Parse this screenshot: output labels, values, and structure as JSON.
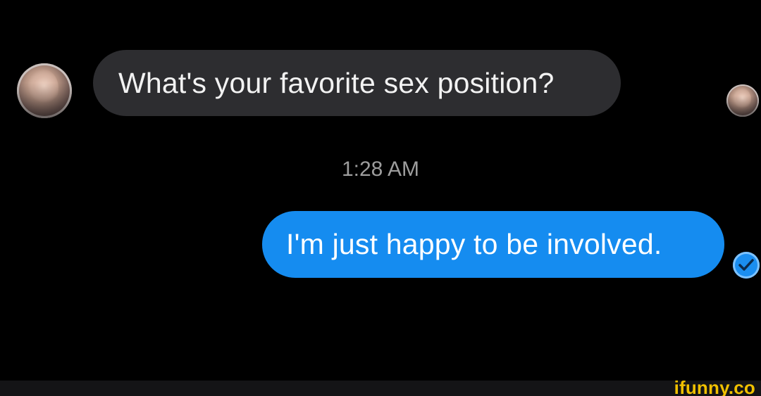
{
  "conversation": {
    "incoming_message": "What's your favorite sex position?",
    "timestamp": "1:28 AM",
    "outgoing_message": "I'm just happy to be involved.",
    "sent_status_icon": "check-circle-icon"
  },
  "watermark": {
    "text": "ifunny.co"
  },
  "colors": {
    "background": "#000000",
    "incoming_bubble": "#2d2d30",
    "outgoing_bubble": "#158cf0",
    "timestamp_text": "#9d9d9d",
    "watermark": "#f0c000"
  }
}
